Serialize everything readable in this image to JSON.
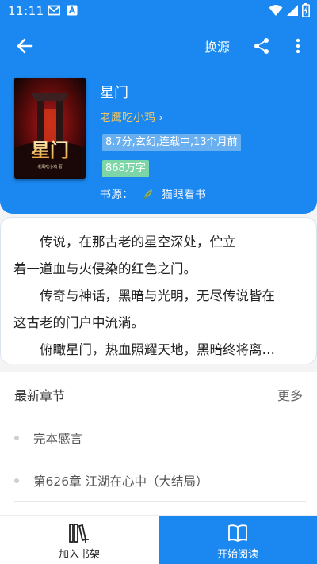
{
  "status_bar": {
    "time": "11:11"
  },
  "toolbar": {
    "change_source": "换源"
  },
  "book": {
    "title": "星门",
    "author": "老鹰吃小鸡",
    "author_chevron": "›",
    "meta_tag": "8.7分,玄幻,连载中,13个月前",
    "word_count": "868万字",
    "source_label": "书源：",
    "source_name": "猫眼看书",
    "cover_title": "星门",
    "cover_author": "老鹰吃小鸡 著"
  },
  "synopsis": {
    "lines": [
      "　　传说，在那古老的星空深处，伫立",
      "着一道血与火侵染的红色之门。",
      "　　传奇与神话，黑暗与光明，无尽传说皆在",
      "这古老的门户中流淌。",
      "　　俯瞰星门，热血照耀天地，黑暗终将离…"
    ]
  },
  "chapters": {
    "header": "最新章节",
    "more": "更多",
    "items": [
      {
        "title": "完本感言"
      },
      {
        "title": "第626章 江湖在心中（大结局）"
      }
    ]
  },
  "bottom": {
    "add_shelf": "加入书架",
    "start_read": "开始阅读"
  },
  "colors": {
    "primary": "#1a88f0",
    "author": "#f6c75e",
    "tag_blue": "#6ab0f0",
    "tag_green": "#7cd6a8"
  }
}
